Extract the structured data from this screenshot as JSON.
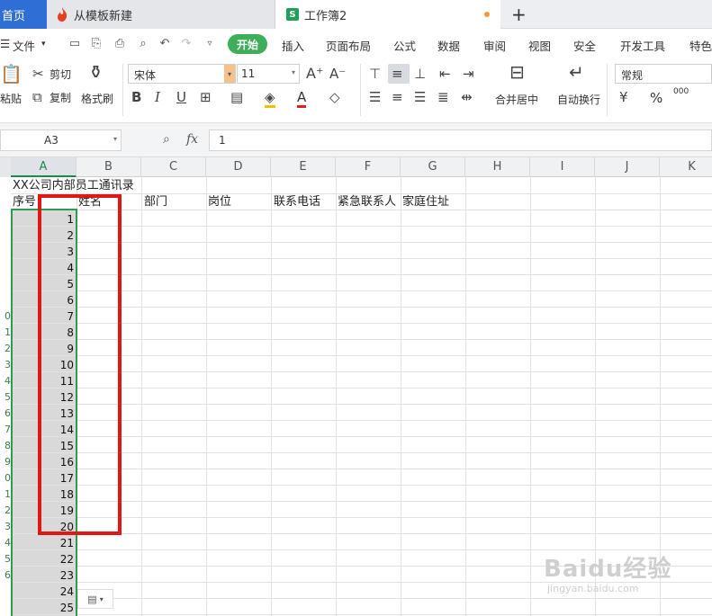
{
  "tabs": {
    "home": "首页",
    "template": "从模板新建",
    "workbook": "工作簿2"
  },
  "menu": {
    "file": "文件",
    "start": "开始",
    "items": [
      "插入",
      "页面布局",
      "公式",
      "数据",
      "审阅",
      "视图",
      "安全",
      "开发工具",
      "特色"
    ]
  },
  "ribbon": {
    "paste": "粘贴",
    "cut": "剪切",
    "copy": "复制",
    "format_painter": "格式刷",
    "font_name": "宋体",
    "font_size": "11",
    "merge_center": "合并居中",
    "auto_wrap": "自动换行",
    "number_format": "常规",
    "percent": "%",
    "decimals": "000"
  },
  "formula_bar": {
    "name_box": "A3",
    "fx": "fx",
    "value": "1"
  },
  "grid": {
    "columns": [
      "A",
      "B",
      "C",
      "D",
      "E",
      "F",
      "G",
      "H",
      "I",
      "J",
      "K"
    ],
    "row_header_tails": [
      "",
      "",
      "",
      "",
      "",
      "",
      "",
      "",
      "0",
      "1",
      "2",
      "3",
      "4",
      "5",
      "6",
      "7",
      "8",
      "9",
      "0",
      "1",
      "2",
      "3",
      "4",
      "5",
      "6"
    ],
    "title": "XX公司内部员工通讯录",
    "headers": [
      "序号",
      "姓名",
      "部门",
      "岗位",
      "联系电话",
      "紧急联系人",
      "家庭住址"
    ],
    "numbers": [
      "1",
      "2",
      "3",
      "4",
      "5",
      "6",
      "7",
      "8",
      "9",
      "10",
      "11",
      "12",
      "13",
      "14",
      "15",
      "16",
      "17",
      "18",
      "19",
      "20",
      "21",
      "22",
      "23",
      "24",
      "25"
    ]
  },
  "watermark": {
    "main": "Baidu经验",
    "sub": "jingyan.baidu.com"
  },
  "colors": {
    "home_tab": "#2f6fd5",
    "start_button": "#3fae58",
    "selection": "#2e9b4f",
    "highlight_box": "#e01717"
  }
}
